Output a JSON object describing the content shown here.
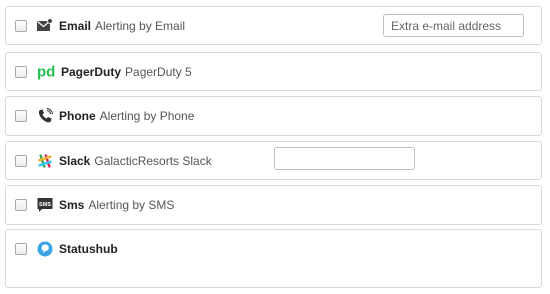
{
  "integrations": [
    {
      "name": "Email",
      "description": "Alerting by Email",
      "icon": "email-icon",
      "input_placeholder": "Extra e-mail address"
    },
    {
      "name": "PagerDuty",
      "description": "PagerDuty 5",
      "icon": "pagerduty-icon",
      "brand_color": "#25c151"
    },
    {
      "name": "Phone",
      "description": "Alerting by Phone",
      "icon": "phone-icon"
    },
    {
      "name": "Slack",
      "description": "GalacticResorts Slack",
      "icon": "slack-icon",
      "input_value": ""
    },
    {
      "name": "Sms",
      "description": "Alerting by SMS",
      "icon": "sms-icon"
    },
    {
      "name": "Statushub",
      "description": "",
      "icon": "statushub-icon",
      "brand_color": "#3aa3e3"
    }
  ]
}
